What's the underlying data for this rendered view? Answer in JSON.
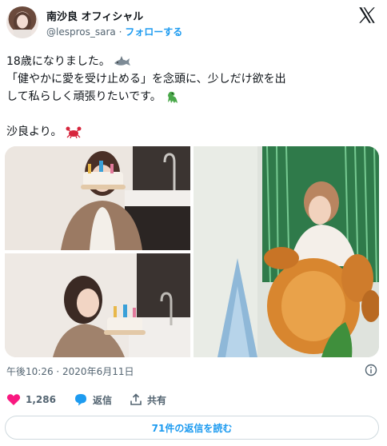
{
  "header": {
    "display_name": "南沙良 オフィシャル",
    "handle": "@lespros_sara",
    "separator": "·",
    "follow_label": "フォローする"
  },
  "tweet": {
    "line1": "18歳になりました。",
    "line2": "「健やかに愛を受け止める」を念頭に、少しだけ欲を出",
    "line3": "して私らしく頑張りたいです。",
    "line4": "沙良より。",
    "emojis": [
      "shark-emoji",
      "dinosaur-emoji",
      "crab-emoji"
    ]
  },
  "media": {
    "photos": [
      "photo-cake-top",
      "photo-cake-bottom",
      "photo-dinosaur-balloons"
    ]
  },
  "meta": {
    "timestamp": "午後10:26 · 2020年6月11日"
  },
  "actions": {
    "like_count": "1,286",
    "reply_label": "返信",
    "share_label": "共有"
  },
  "footer": {
    "read_replies_label": "71件の返信を読む"
  },
  "colors": {
    "accent": "#1d9bf0",
    "like": "#f91880",
    "text": "#0f1419",
    "secondary": "#536471"
  }
}
